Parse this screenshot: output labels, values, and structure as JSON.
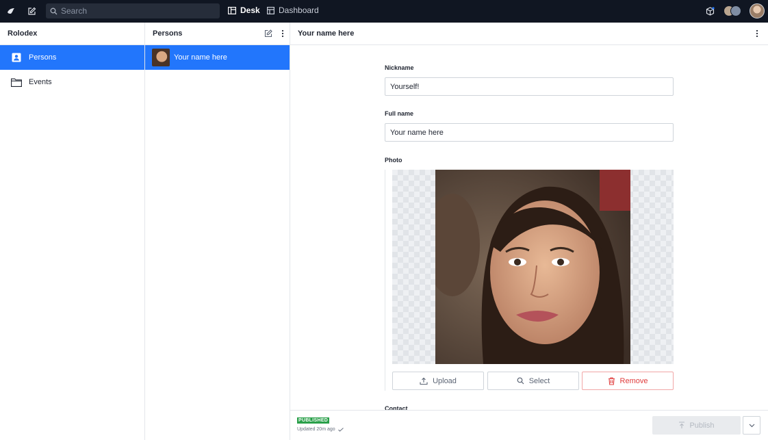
{
  "topbar": {
    "search_placeholder": "Search",
    "desk_label": "Desk",
    "dashboard_label": "Dashboard"
  },
  "tools": {
    "title": "Rolodex",
    "items": [
      {
        "label": "Persons",
        "icon": "contact-card-icon",
        "selected": true
      },
      {
        "label": "Events",
        "icon": "folder-icon",
        "selected": false
      }
    ]
  },
  "list": {
    "title": "Persons",
    "items": [
      {
        "label": "Your name here",
        "selected": true
      }
    ]
  },
  "document": {
    "title": "Your name here",
    "fields": {
      "nickname_label": "Nickname",
      "nickname_value": "Yourself!",
      "fullname_label": "Full name",
      "fullname_value": "Your name here",
      "photo_label": "Photo",
      "contact_label": "Contact"
    },
    "photo_actions": {
      "upload": "Upload",
      "select": "Select",
      "remove": "Remove"
    }
  },
  "footer": {
    "status_badge": "PUBLISHED",
    "updated_text": "Updated 20m ago",
    "publish_label": "Publish"
  },
  "colors": {
    "accent": "#2276fc",
    "topbar": "#101622",
    "published": "#2aa04a",
    "danger": "#e03b3b"
  }
}
